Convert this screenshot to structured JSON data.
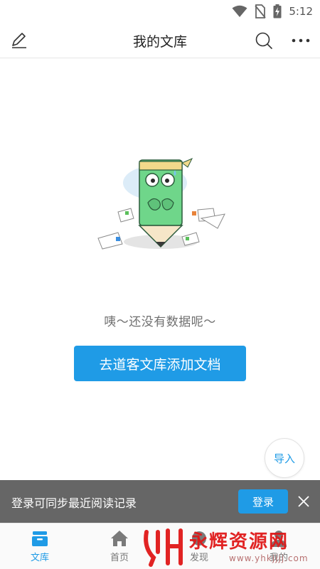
{
  "status_bar": {
    "time": "5:12"
  },
  "header": {
    "title": "我的文库"
  },
  "empty_state": {
    "message": "咦～还没有数据呢～",
    "button_label": "去道客文库添加文档"
  },
  "import_button": {
    "label": "导入"
  },
  "login_banner": {
    "text": "登录可同步最近阅读记录",
    "button_label": "登录"
  },
  "bottom_nav": {
    "items": [
      {
        "label": "文库",
        "icon": "library-icon",
        "active": true
      },
      {
        "label": "首页",
        "icon": "home-icon",
        "active": false
      },
      {
        "label": "发现",
        "icon": "discover-icon",
        "active": false
      },
      {
        "label": "我的",
        "icon": "profile-icon",
        "active": false
      }
    ]
  },
  "watermark": {
    "title": "永辉资源网",
    "url": "www.yhkjjjj.com"
  },
  "colors": {
    "accent": "#1f9be6",
    "banner_bg": "#666666",
    "watermark_red": "#e01818"
  }
}
